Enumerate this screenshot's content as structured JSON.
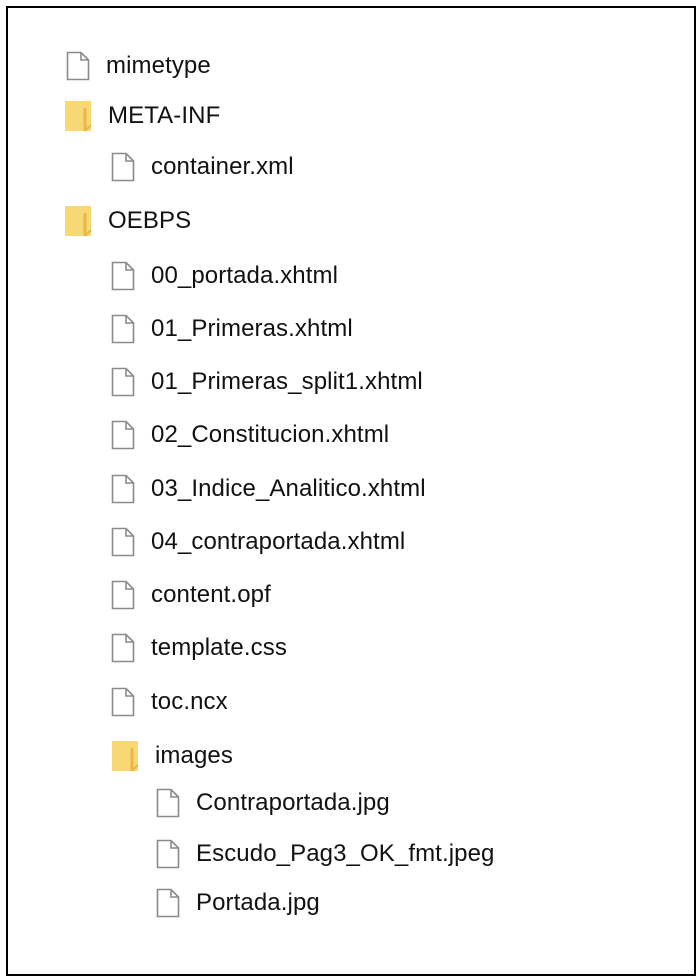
{
  "tree": [
    {
      "label": "mimetype",
      "type": "file"
    },
    {
      "label": "META-INF",
      "type": "folder"
    },
    {
      "label": "container.xml",
      "type": "file"
    },
    {
      "label": "OEBPS",
      "type": "folder"
    },
    {
      "label": "00_portada.xhtml",
      "type": "file"
    },
    {
      "label": "01_Primeras.xhtml",
      "type": "file"
    },
    {
      "label": "01_Primeras_split1.xhtml",
      "type": "file"
    },
    {
      "label": "02_Constitucion.xhtml",
      "type": "file"
    },
    {
      "label": "03_Indice_Analitico.xhtml",
      "type": "file"
    },
    {
      "label": "04_contraportada.xhtml",
      "type": "file"
    },
    {
      "label": "content.opf",
      "type": "file"
    },
    {
      "label": "template.css",
      "type": "file"
    },
    {
      "label": "toc.ncx",
      "type": "file"
    },
    {
      "label": "images",
      "type": "folder"
    },
    {
      "label": "Contraportada.jpg",
      "type": "file"
    },
    {
      "label": "Escudo_Pag3_OK_fmt.jpeg",
      "type": "file"
    },
    {
      "label": "Portada.jpg",
      "type": "file"
    }
  ],
  "colors": {
    "folder": "#f8d775",
    "folder_edge": "#e8b949",
    "file_outline": "#8a8a8a",
    "text": "#111111"
  }
}
